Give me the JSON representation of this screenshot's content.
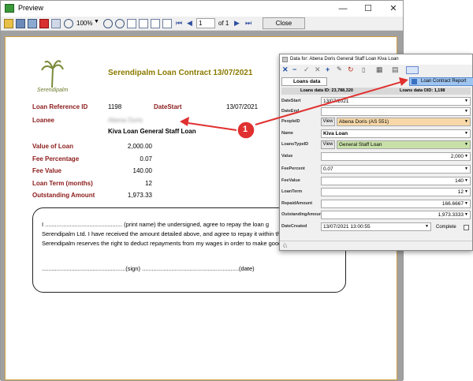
{
  "preview": {
    "title": "Preview",
    "zoom": "100%",
    "page": "1",
    "of": "of 1",
    "close": "Close"
  },
  "report": {
    "company": "Serendipalm",
    "title": "Serendipalm Loan Contract 13/07/2021",
    "ref_label": "Loan Reference ID",
    "ref_value": "1198",
    "datestart_label": "DateStart",
    "datestart_value": "13/07/2021",
    "loanee_label": "Loanee",
    "loanee_value": "Abena Doris",
    "loan_type": "Kiva Loan General Staff Loan",
    "fields": [
      {
        "label": "Value of Loan",
        "value": "2,000.00"
      },
      {
        "label": "Fee Percentage",
        "value": "0.07"
      },
      {
        "label": "Fee Value",
        "value": "140.00"
      },
      {
        "label": "Loan Term (months)",
        "value": "12"
      },
      {
        "label": "Outstanding Amount",
        "value": "1,973.33"
      }
    ],
    "agreement_1": "I ............................................... (print name) the undersigned, agree to repay the loan g",
    "agreement_2": "Serendipalm Ltd. I have received the amount detailed above, and agree to repay it within th",
    "agreement_3": "Serendipalm reserves the right to deduct repayments from my wages in order to make good",
    "sign_line": "...................................................(sign) ...........................................................(date)"
  },
  "data_window": {
    "title": "Data for: Abena Doris General Staff Loan Kiva Loan",
    "menu_item": "Loan Contract Report",
    "tab": "Loans data",
    "id_left": "Loans data ID: 23,788,320",
    "id_right": "Loans data OID: 1,198",
    "view": "View",
    "fields": [
      {
        "label": "DateStart",
        "value": "13/07/2021"
      },
      {
        "label": "DateEnd",
        "value": ""
      },
      {
        "label": "PeopleID",
        "value": "Abena Doris (AS 551)"
      },
      {
        "label": "Name",
        "value": "Kiva Loan"
      },
      {
        "label": "LoansTypeID",
        "value": "General Staff Loan"
      },
      {
        "label": "Value",
        "value": "2,000"
      },
      {
        "label": "FeePercent",
        "value": "0.07"
      },
      {
        "label": "FeeValue",
        "value": "140"
      },
      {
        "label": "LoanTerm",
        "value": "12"
      },
      {
        "label": "RepaidAmount",
        "value": "166.6667"
      },
      {
        "label": "OutstandingAmount",
        "value": "1,973.3333"
      },
      {
        "label": "DateCreated",
        "value": "13/07/2021 13:00:55"
      }
    ],
    "complete": "Complete"
  },
  "callout": "1",
  "colors": {
    "accent": "#8b1a1a",
    "title": "#8b7a00",
    "arrow": "#e0302f",
    "people": "#f8d8a8",
    "loantype": "#c8e0a8"
  }
}
